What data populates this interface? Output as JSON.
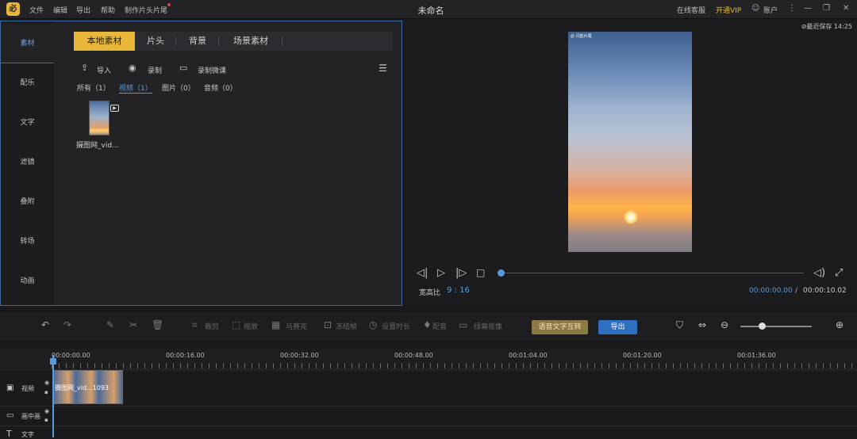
{
  "titlebar": {
    "menus": [
      "文件",
      "编辑",
      "导出",
      "帮助",
      "制作片头片尾"
    ],
    "title": "未命名",
    "online_service": "在线客服",
    "vip": "开通VIP",
    "account": "账户",
    "logo_glyph": "必"
  },
  "sidebar": {
    "items": [
      "素材",
      "配乐",
      "文字",
      "滤镜",
      "叠附",
      "转场",
      "动画"
    ]
  },
  "media": {
    "tabs": [
      "本地素材",
      "片头",
      "背景",
      "场景素材"
    ],
    "tools": [
      "导入",
      "录制",
      "录制微课"
    ],
    "filters": [
      "所有（1）",
      "视频（1）",
      "图片（0）",
      "音频（0）"
    ],
    "item_label": "摄图网_vid..."
  },
  "preview": {
    "autosave": "⊘最近保存 14:25",
    "watermark": "必 闪剪片尾",
    "aspect_label": "宽高比",
    "aspect_value": "9 : 16",
    "current_time": "00:00:00.00",
    "separator": "/",
    "total_time": "00:00:10.02",
    "progress": 0
  },
  "timeline_toolbar": {
    "tools": [
      "裁剪",
      "缩放",
      "马赛克",
      "冻结帧",
      "设置时长",
      "配音",
      "绿幕抠像"
    ],
    "speech_button": "语音文字互转",
    "export_button": "导出",
    "zoom_level": 0.3
  },
  "ruler": {
    "labels": [
      "00:00:00.00",
      "00:00:16.00",
      "00:00:32.00",
      "00:00:48.00",
      "00:01:04.00",
      "00:01:20.00",
      "00:01:36.00"
    ]
  },
  "tracks": {
    "video": "视频",
    "pip": "画中画",
    "text": "文字",
    "clip_label": "摄图网_vid...1093"
  },
  "colors": {
    "accent_yellow": "#e8b73a",
    "accent_blue": "#5b9ad8",
    "export_blue": "#2e6fc0"
  }
}
